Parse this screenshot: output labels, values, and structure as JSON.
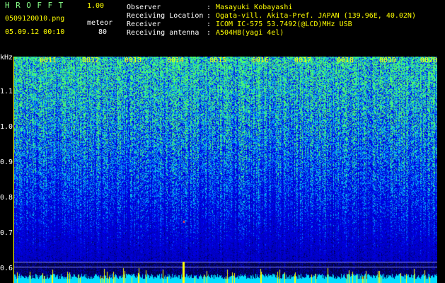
{
  "header": {
    "app_title": "HROFFT",
    "app_version": "1.00",
    "filename": "0509120010.png",
    "mode": "meteor",
    "timestamp": "05.09.12 00:10",
    "count": "80"
  },
  "info": {
    "observer_label": "Observer",
    "observer_value": "Masayuki Kobayashi",
    "location_label": "Receiving Location",
    "location_value": "Ogata-vill. Akita-Pref. JAPAN (139.96E, 40.02N)",
    "receiver_label": "Receiver",
    "receiver_value": "ICOM IC-575 53.7492(@LCD)MHz USB",
    "antenna_label": "Receiving antenna",
    "antenna_value": "A504HB(yagi 4el)",
    "colon": ":"
  },
  "axis": {
    "unit": "kHz",
    "y_ticks": [
      "1.1",
      "1.0",
      "0.9",
      "0.8",
      "0.7",
      "0.6"
    ],
    "time_labels": [
      "0011",
      "0012",
      "0013",
      "0014",
      "0015",
      "0016",
      "0017",
      "0018",
      "0019",
      "0020"
    ]
  },
  "colors": {
    "background": "#000000",
    "accent_yellow": "#ffff00",
    "title_green": "#88ff88",
    "spectrum_blue": "#1a2aff",
    "spectrum_cyan": "#00d8ff",
    "spectrum_green": "#40ff60"
  }
}
